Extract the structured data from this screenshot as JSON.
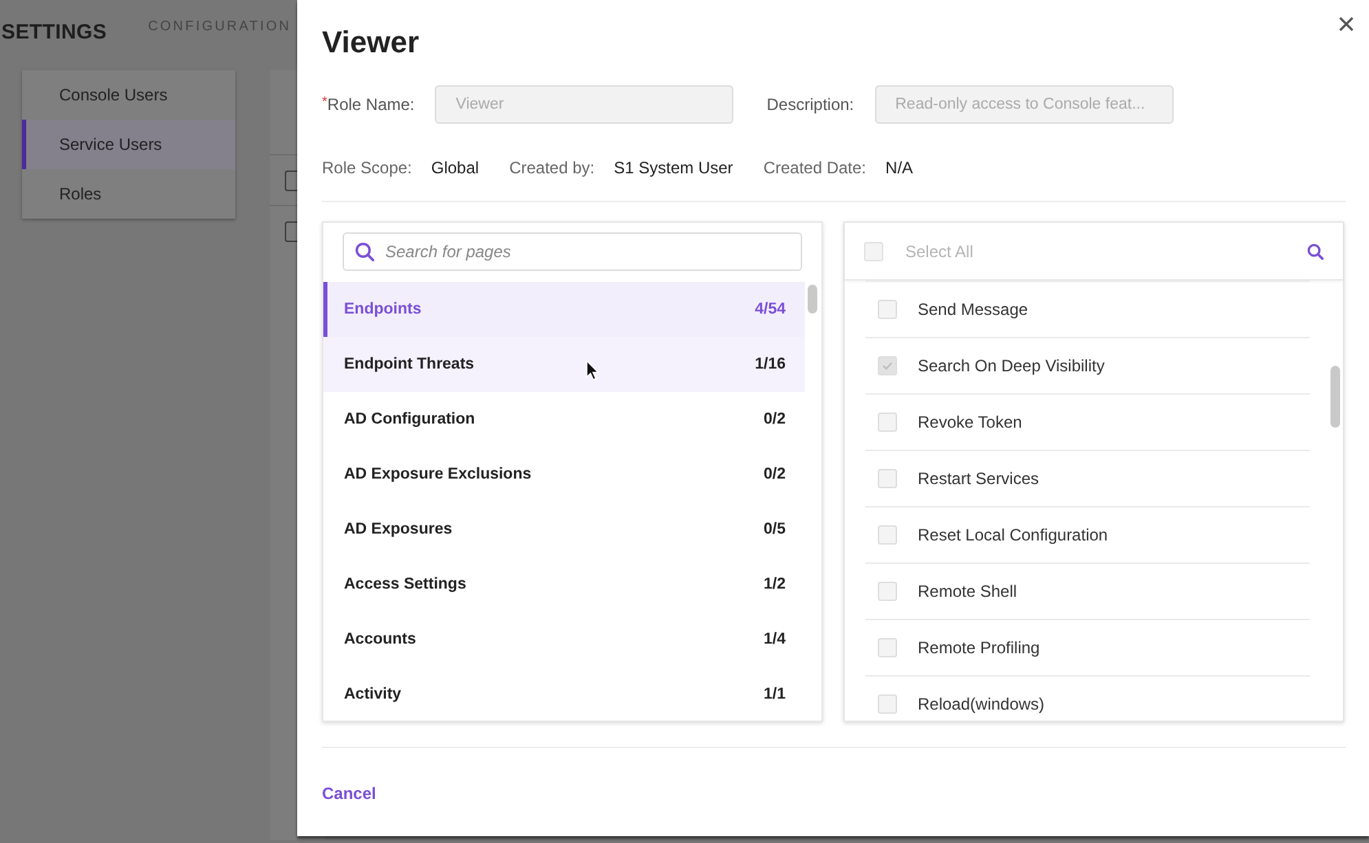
{
  "background_page": {
    "header": {
      "title": "SETTINGS",
      "nav": [
        {
          "label": "CONFIGURATION",
          "selected": false
        }
      ]
    },
    "sidebar": {
      "items": [
        {
          "label": "Console Users",
          "selected": false
        },
        {
          "label": "Service Users",
          "selected": true
        },
        {
          "label": "Roles",
          "selected": false
        }
      ]
    },
    "table": {
      "rows": [
        {
          "checked": false
        },
        {
          "checked": false
        }
      ]
    }
  },
  "dialog": {
    "title": "Viewer",
    "fields": [
      {
        "required_mark": "*",
        "label": "Role Name:",
        "value": "Viewer",
        "disabled": true
      },
      {
        "label": "Description:",
        "value": "Read-only access to Console feat...",
        "disabled": true
      }
    ],
    "info": [
      {
        "label": "Role Scope:",
        "value": "Global"
      },
      {
        "label": "Created by:",
        "value": "S1 System User"
      },
      {
        "label": "Created Date:",
        "value": "N/A"
      }
    ],
    "pages_panel": {
      "search": {
        "placeholder": "Search for pages"
      },
      "items": [
        {
          "name": "Endpoints",
          "count": "4/54",
          "selected": true,
          "hovered": false
        },
        {
          "name": "Endpoint Threats",
          "count": "1/16",
          "selected": false,
          "hovered": true
        },
        {
          "name": "AD Configuration",
          "count": "0/2",
          "selected": false,
          "hovered": false
        },
        {
          "name": "AD Exposure Exclusions",
          "count": "0/2",
          "selected": false,
          "hovered": false
        },
        {
          "name": "AD Exposures",
          "count": "0/5",
          "selected": false,
          "hovered": false
        },
        {
          "name": "Access Settings",
          "count": "1/2",
          "selected": false,
          "hovered": false
        },
        {
          "name": "Accounts",
          "count": "1/4",
          "selected": false,
          "hovered": false
        },
        {
          "name": "Activity",
          "count": "1/1",
          "selected": false,
          "hovered": false
        }
      ]
    },
    "permissions_panel": {
      "select_all": {
        "label": "Select All",
        "checked": false,
        "disabled": true
      },
      "items": [
        {
          "label": "Send Message",
          "checked": false
        },
        {
          "label": "Search On Deep Visibility",
          "checked": true
        },
        {
          "label": "Revoke Token",
          "checked": false
        },
        {
          "label": "Restart Services",
          "checked": false
        },
        {
          "label": "Reset Local Configuration",
          "checked": false
        },
        {
          "label": "Remote Shell",
          "checked": false
        },
        {
          "label": "Remote Profiling",
          "checked": false
        },
        {
          "label": "Reload(windows)",
          "checked": false
        }
      ]
    },
    "footer": {
      "cancel": "Cancel"
    }
  }
}
